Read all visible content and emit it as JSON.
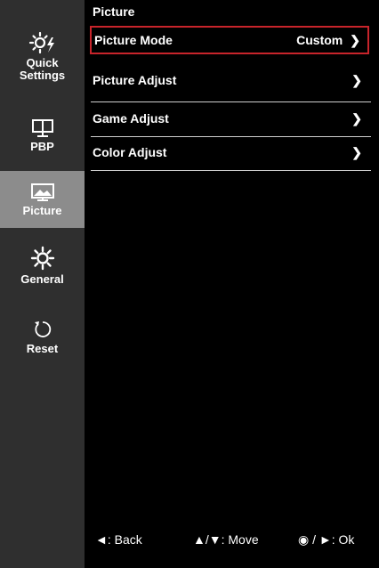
{
  "sidebar": {
    "items": [
      {
        "label_line1": "Quick",
        "label_line2": "Settings",
        "icon": "quick-settings-icon",
        "selected": false
      },
      {
        "label": "PBP",
        "icon": "pbp-monitor-icon",
        "selected": false
      },
      {
        "label": "Picture",
        "icon": "picture-icon",
        "selected": true
      },
      {
        "label": "General",
        "icon": "gear-icon",
        "selected": false
      },
      {
        "label": "Reset",
        "icon": "reset-icon",
        "selected": false
      }
    ]
  },
  "main": {
    "title": "Picture",
    "rows": [
      {
        "label": "Picture Mode",
        "value": "Custom",
        "chevron": "❯",
        "focused": true
      },
      {
        "label": "Picture Adjust",
        "value": "",
        "chevron": "❯",
        "focused": false
      },
      {
        "label": "Game Adjust",
        "value": "",
        "chevron": "❯",
        "focused": false
      },
      {
        "label": "Color Adjust",
        "value": "",
        "chevron": "❯",
        "focused": false
      }
    ]
  },
  "footer": {
    "back": "◄: Back",
    "move": "▲/▼: Move",
    "ok": "◉ / ►: Ok"
  },
  "colors": {
    "sidebar_bg": "#2f2f2f",
    "selected_bg": "#8c8c8c",
    "focus_border": "#c8242b",
    "main_bg": "#000000"
  }
}
